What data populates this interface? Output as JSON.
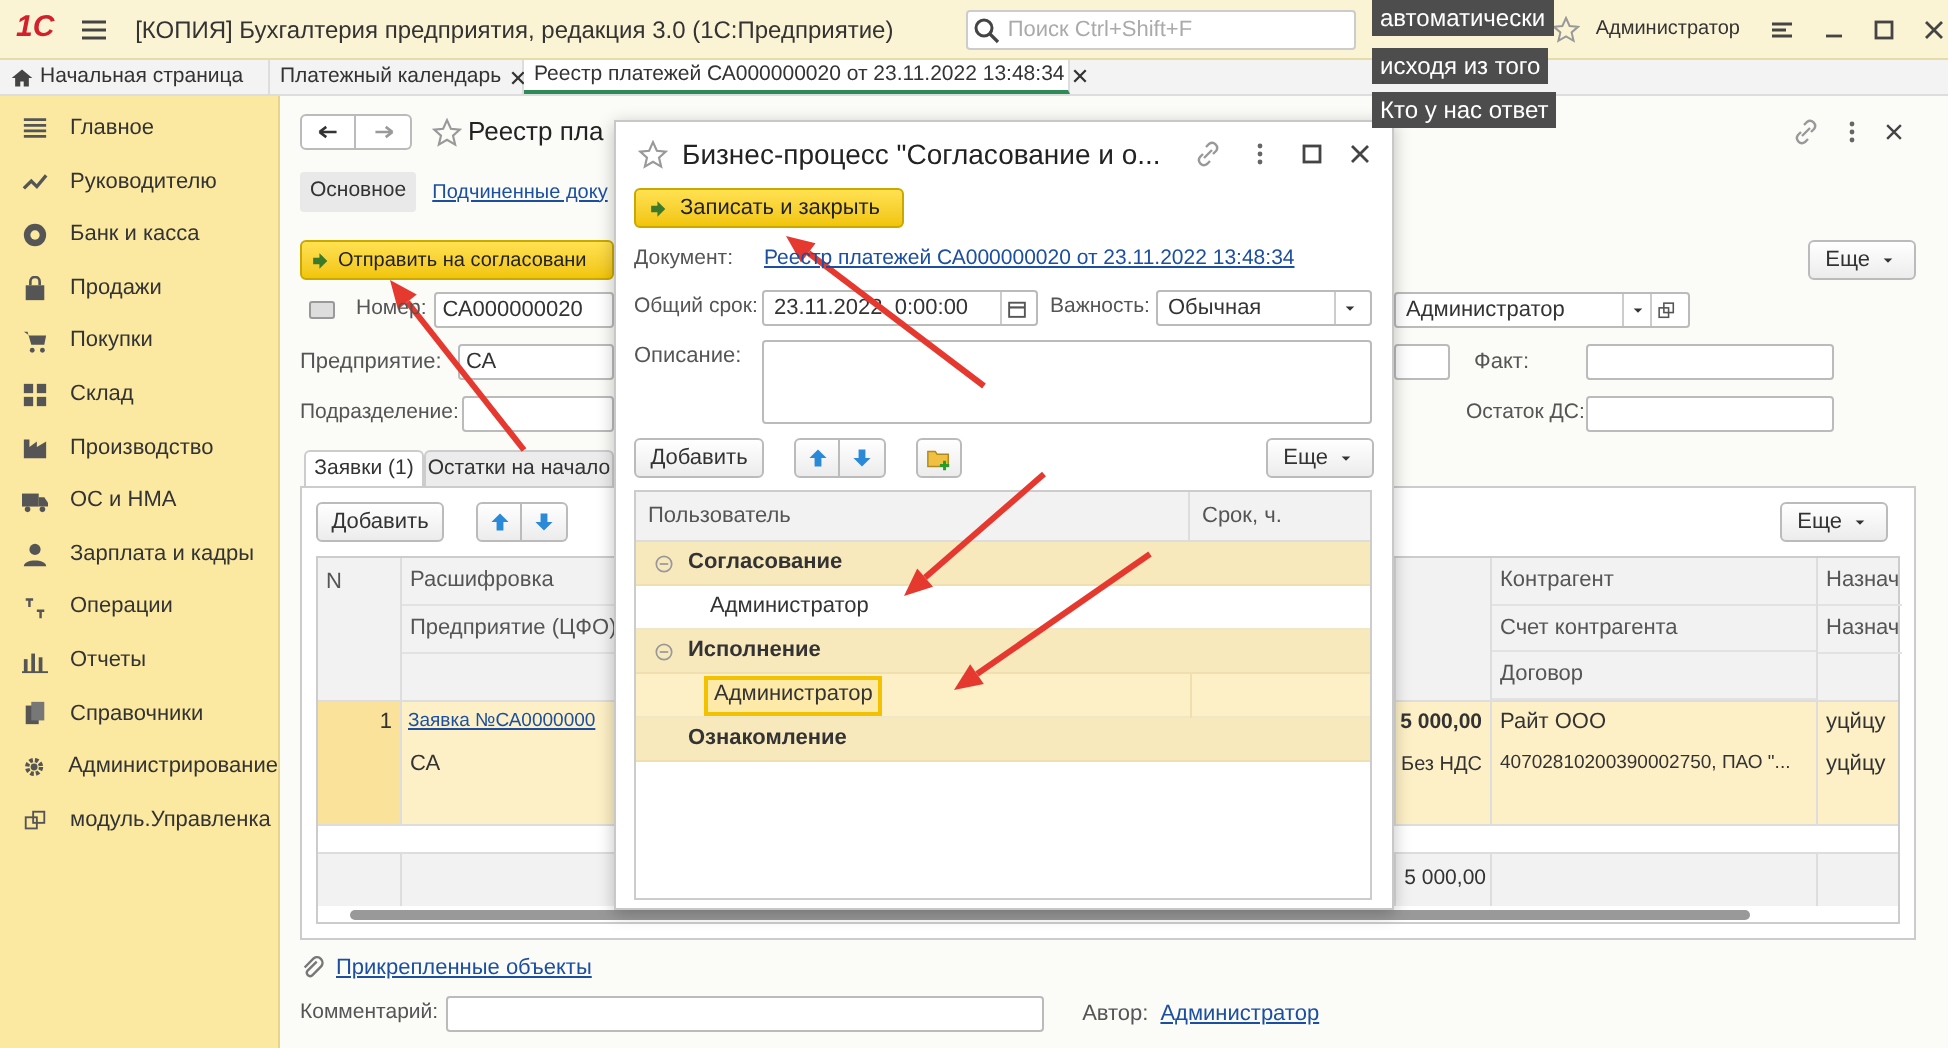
{
  "app_bar": {
    "logo": "1С",
    "title": "[КОПИЯ] Бухгалтерия предприятия, редакция 3.0  (1С:Предприятие)",
    "search": {
      "placeholder": "Поиск Ctrl+Shift+F"
    },
    "user": "Администратор"
  },
  "captions": [
    "автоматически",
    "исходя из того",
    "Кто у нас ответ"
  ],
  "open_tabs": [
    {
      "label": "Начальная страница",
      "kind": "home",
      "selected": false
    },
    {
      "label": "Платежный календарь",
      "kind": "document",
      "selected": false
    },
    {
      "label": "Реестр платежей СА000000020 от 23.11.2022 13:48:34",
      "kind": "document",
      "selected": true
    }
  ],
  "sidebar": {
    "items": [
      {
        "label": "Главное"
      },
      {
        "label": "Руководителю"
      },
      {
        "label": "Банк и касса"
      },
      {
        "label": "Продажи"
      },
      {
        "label": "Покупки"
      },
      {
        "label": "Склад"
      },
      {
        "label": "Производство"
      },
      {
        "label": "ОС и НМА"
      },
      {
        "label": "Зарплата и кадры"
      },
      {
        "label": "Операции"
      },
      {
        "label": "Отчеты"
      },
      {
        "label": "Справочники"
      },
      {
        "label": "Администрирование"
      },
      {
        "label": "модуль.Управленка"
      }
    ]
  },
  "form": {
    "title": "Реестр пла",
    "sections": [
      {
        "label": "Основное",
        "selected": true
      },
      {
        "label": "Подчиненные доку",
        "selected": false
      }
    ],
    "send_button": "Отправить на согласовани",
    "more_button": "Еще",
    "number": {
      "label": "Номер:",
      "value": "СА000000020"
    },
    "responsible": {
      "value": "Администратор"
    },
    "enterprise": {
      "label": "Предприятие:",
      "value": "СА"
    },
    "department": {
      "label": "Подразделение:"
    },
    "fact": {
      "label": "Факт:"
    },
    "balance": {
      "label": "Остаток ДС:"
    },
    "tabs": [
      {
        "label": "Заявки (1)",
        "selected": true
      },
      {
        "label": "Остатки на начало",
        "selected": false
      }
    ],
    "table": {
      "add_button": "Добавить",
      "more_button": "Еще",
      "columns": [
        {
          "lines": [
            "N"
          ]
        },
        {
          "lines": [
            "Расшифровка",
            "Предприятие (ЦФО)"
          ]
        },
        {
          "lines": [
            "Контрагент",
            "Счет контрагента",
            "Договор"
          ]
        },
        {
          "lines": [
            "Назнач",
            "Назнач"
          ]
        }
      ],
      "rows": [
        {
          "n": "1",
          "request": "Заявка №СА0000000",
          "enterprise": "СА",
          "amount": "5 000,00",
          "vat": "Без НДС",
          "counterparty": "Райт ООО",
          "account": "40702810200390002750, ПАО \"...",
          "purpose": "уцйцу",
          "purpose_2": "уцйцу",
          "selected": true
        }
      ],
      "total": "5 000,00"
    },
    "attachments_link": "Прикрепленные объекты",
    "comment": {
      "label": "Комментарий:"
    },
    "author": {
      "label": "Автор:",
      "value": "Администратор"
    }
  },
  "dialog": {
    "title": "Бизнес-процесс \"Согласование и о...",
    "save_button": "Записать и закрыть",
    "document": {
      "label": "Документ:",
      "value": "Реестр платежей СА000000020 от 23.11.2022 13:48:34"
    },
    "deadline": {
      "label": "Общий срок:",
      "value": "23.11.2022  0:00:00"
    },
    "importance": {
      "label": "Важность:",
      "value": "Обычная"
    },
    "description": {
      "label": "Описание:"
    },
    "add_button": "Добавить",
    "more_button": "Еще",
    "columns": [
      "Пользователь",
      "Срок, ч."
    ],
    "groups": [
      {
        "label": "Согласование",
        "expanded": true,
        "children": [
          {
            "label": "Администратор",
            "selected": false
          }
        ]
      },
      {
        "label": "Исполнение",
        "expanded": true,
        "children": [
          {
            "label": "Администратор",
            "selected": true
          }
        ]
      },
      {
        "label": "Ознакомление"
      }
    ]
  }
}
